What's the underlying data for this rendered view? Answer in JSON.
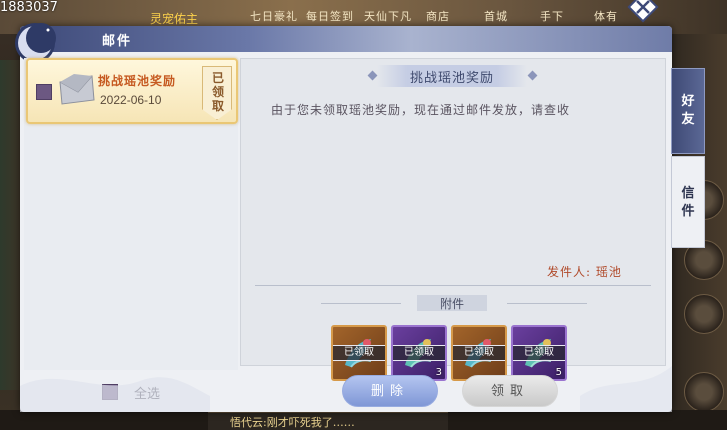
{
  "background": {
    "score": "1883037",
    "guard_label": "灵宠佑主",
    "top_tabs": [
      "七日豪礼",
      "每日签到",
      "天仙下凡",
      "商店",
      "首城",
      "手下",
      "体有"
    ],
    "chat_text": "悟代云:刚才吓死我了……"
  },
  "window": {
    "title": "邮件"
  },
  "mail_list": [
    {
      "title": "挑战瑶池奖励",
      "date": "2022-06-10",
      "status": "已领取"
    }
  ],
  "content": {
    "title": "挑战瑶池奖励",
    "body": "由于您未领取瑶池奖励，现在通过邮件发放，请查收",
    "sender_label": "发件人:",
    "sender_name": "瑶池",
    "attachments_label": "附件",
    "attachments": [
      {
        "rarity": "gold",
        "status": "已领取",
        "count": ""
      },
      {
        "rarity": "purple",
        "status": "已领取",
        "count": "3"
      },
      {
        "rarity": "gold",
        "status": "已领取",
        "count": ""
      },
      {
        "rarity": "purple",
        "status": "已领取",
        "count": "5"
      }
    ]
  },
  "side_tabs": {
    "friend": "好友",
    "letter": "信件"
  },
  "footer": {
    "select_all": "全选",
    "delete": "删除",
    "claim": "领取"
  },
  "colors": {
    "accent_title": "#3d4978",
    "mail_title": "#c65a21",
    "sender": "#b04a2a",
    "checkbox": "#6c5882"
  }
}
